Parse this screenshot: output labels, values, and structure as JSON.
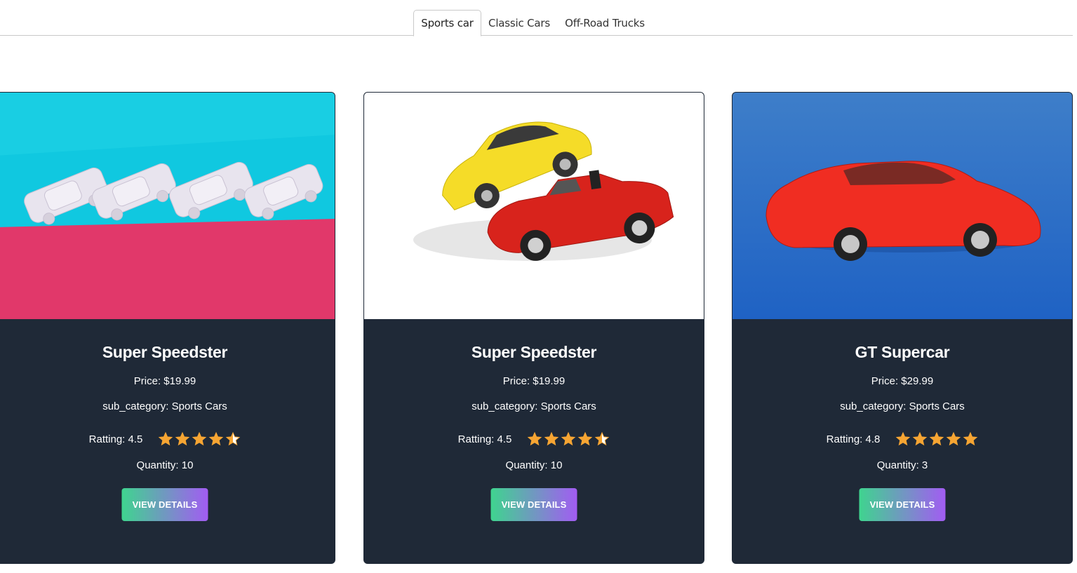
{
  "tabs": [
    {
      "label": "Sports car",
      "active": true
    },
    {
      "label": "Classic Cars",
      "active": false
    },
    {
      "label": "Off-Road Trucks",
      "active": false
    }
  ],
  "cards": [
    {
      "title": "Super Speedster",
      "price": "Price: $19.99",
      "sub_category": "sub_category: Sports Cars",
      "rating_label": "Ratting: 4.5",
      "rating": 4.5,
      "quantity": "Quantity: 10",
      "button_label": "VIEW DETAILS",
      "image": "four white toy cars on cyan and pink background"
    },
    {
      "title": "Super Speedster",
      "price": "Price: $19.99",
      "sub_category": "sub_category: Sports Cars",
      "rating_label": "Ratting: 4.5",
      "rating": 4.5,
      "quantity": "Quantity: 10",
      "button_label": "VIEW DETAILS",
      "image": "yellow and red toy cars on white background"
    },
    {
      "title": "GT Supercar",
      "price": "Price: $29.99",
      "sub_category": "sub_category: Sports Cars",
      "rating_label": "Ratting: 4.8",
      "rating": 4.8,
      "quantity": "Quantity: 3",
      "button_label": "VIEW DETAILS",
      "image": "red toy sports car on blue background"
    }
  ],
  "colors": {
    "card_body": "#1f2937",
    "star": "#f6a533",
    "button_start": "#3fd48f",
    "button_end": "#a25cf2"
  }
}
